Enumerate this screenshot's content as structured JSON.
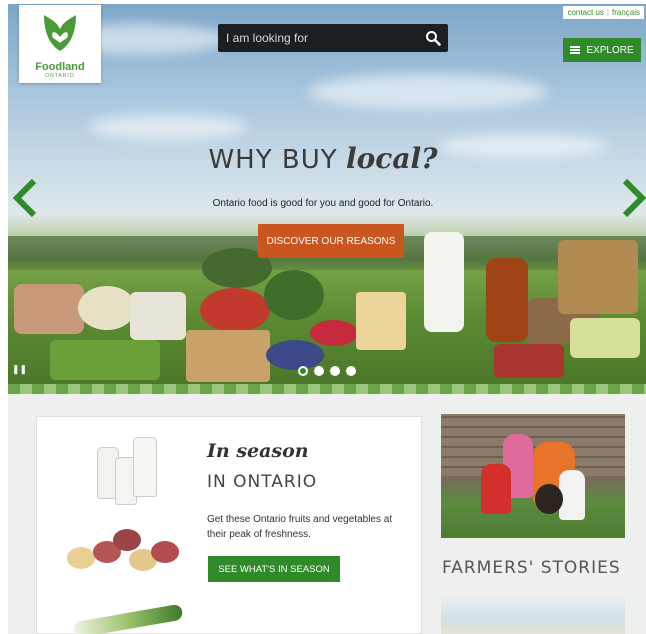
{
  "brand": {
    "name": "Foodland",
    "sub": "ONTARIO"
  },
  "search": {
    "placeholder": "I am looking for"
  },
  "toplinks": {
    "contact": "contact us",
    "sep": "|",
    "lang": "français"
  },
  "nav": {
    "explore": "EXPLORE"
  },
  "hero": {
    "title_a": "WHY BUY",
    "title_b": "local?",
    "subtitle": "Ontario food is good for you and good for Ontario.",
    "cta": "DISCOVER OUR REASONS",
    "slide_count": 4,
    "active_slide": 1
  },
  "season": {
    "title": "In season",
    "subtitle": "IN ONTARIO",
    "desc": "Get these Ontario fruits and vegetables at their peak of freshness.",
    "cta": "SEE WHAT'S IN SEASON"
  },
  "farmers": {
    "title": "FARMERS' STORIES"
  },
  "colors": {
    "brand_green": "#2f8a2a",
    "cta_orange": "#c9551f"
  }
}
